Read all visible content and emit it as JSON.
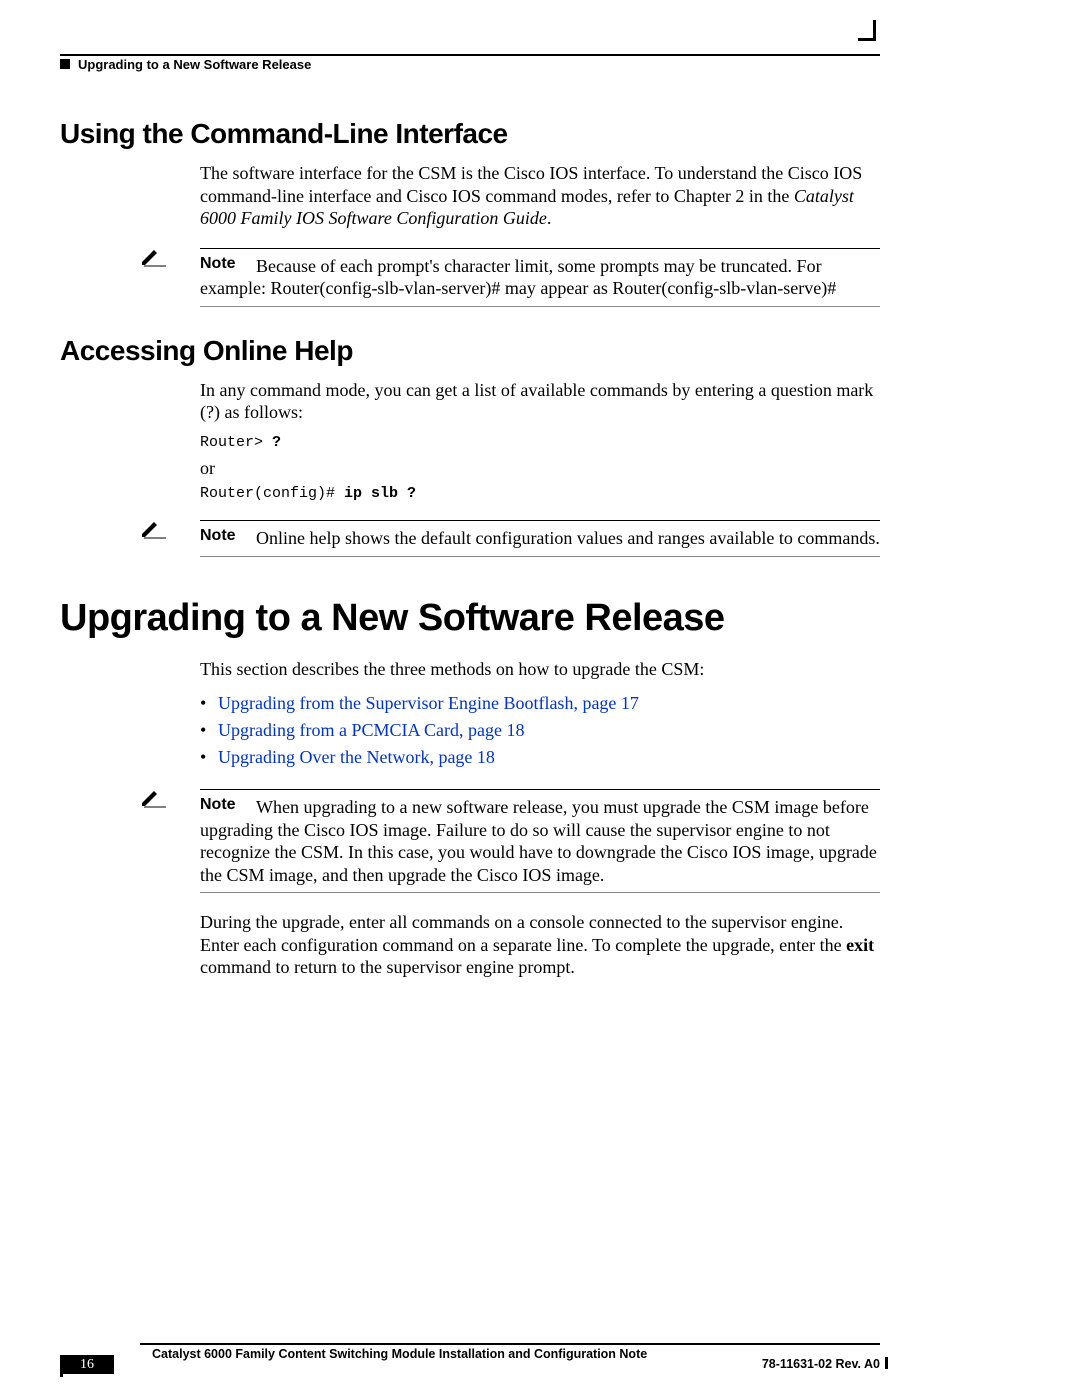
{
  "running_header": "Upgrading to a New Software Release",
  "section1": {
    "title": "Using the Command-Line Interface",
    "para_a": "The software interface for the CSM is the Cisco IOS interface. To understand the Cisco IOS command-line interface and Cisco IOS command modes, refer to Chapter 2 in the ",
    "para_italic": "Catalyst 6000 Family IOS Software Configuration Guide",
    "para_b": ".",
    "note_label": "Note",
    "note_text": "Because of each prompt's character limit, some prompts may be truncated. For example: Router(config-slb-vlan-server)# may appear as Router(config-slb-vlan-serve)#"
  },
  "section2": {
    "title": "Accessing Online Help",
    "para": "In any command mode, you can get a list of available commands by entering a question mark (?) as follows:",
    "code1_a": "Router> ",
    "code1_b": "?",
    "or": "or",
    "code2_a": "Router(config)# ",
    "code2_b": "ip slb ?",
    "note_label": "Note",
    "note_text": "Online help shows the default configuration values and ranges available to commands."
  },
  "chapter": {
    "title": "Upgrading to a New Software Release",
    "intro": "This section describes the three methods on how to upgrade the CSM:",
    "links": [
      "Upgrading from the Supervisor Engine Bootflash, page 17",
      "Upgrading from a PCMCIA Card, page 18",
      "Upgrading Over the Network, page 18"
    ],
    "note_label": "Note",
    "note_text": "When upgrading to a new software release, you must upgrade the CSM image before upgrading the Cisco IOS image. Failure to do so will cause the supervisor engine to not recognize the CSM. In this case, you would have to downgrade the Cisco IOS image, upgrade the CSM image, and then upgrade the Cisco IOS image.",
    "para2_a": "During the upgrade, enter all commands on a console connected to the supervisor engine. Enter each configuration command on a separate line. To complete the upgrade, enter the ",
    "para2_bold": "exit",
    "para2_b": " command to return to the supervisor engine prompt."
  },
  "footer": {
    "title": "Catalyst 6000 Family Content Switching Module Installation and Configuration Note",
    "page": "16",
    "doc": "78-11631-02 Rev. A0"
  }
}
